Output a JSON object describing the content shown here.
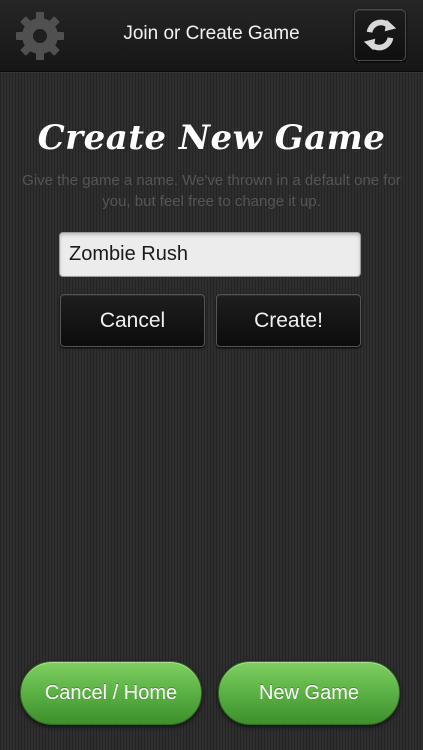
{
  "header": {
    "title": "Join or Create Game",
    "settings_icon": "gear-icon",
    "refresh_icon": "refresh-icon"
  },
  "create_panel": {
    "heading": "Create New Game",
    "description": "Give the game a name.  We've thrown in a default one for you, but feel free to change it up.",
    "name_input": {
      "value": "Zombie Rush",
      "placeholder": ""
    },
    "cancel_label": "Cancel",
    "create_label": "Create!"
  },
  "footer": {
    "home_label": "Cancel / Home",
    "new_game_label": "New Game"
  },
  "colors": {
    "background": "#2b2b2b",
    "topbar": "#1c1c1c",
    "green_button": "#5bb144",
    "description_text": "#555555"
  }
}
